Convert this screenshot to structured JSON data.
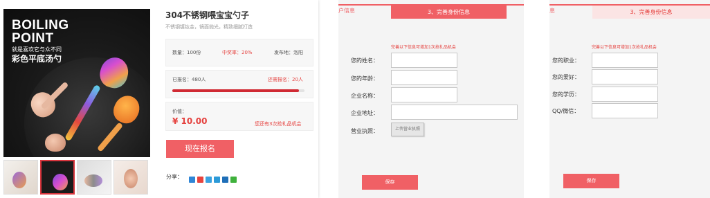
{
  "product": {
    "image_brand_line1": "BOILING",
    "image_brand_line2": "POINT",
    "image_tagline": "就是喜欢它与众不同",
    "image_headline": "彩色平底汤勺",
    "title": "304不锈钢喂宝宝勺子",
    "subtitle": "不锈钢镀钛金，镜面抛光，精致细腻打造",
    "quantity": "数量：100份",
    "win_rate": "中奖率：20%",
    "ship_from": "发布地：洛阳",
    "signed_up": "已报名：480人",
    "remaining": "还需报名：20人",
    "progress_fraction": 0.96,
    "value_label": "价值：",
    "price": "¥ 10.00",
    "chances_note": "您还有3次抢礼品机会",
    "signup_button": "现在报名",
    "share_label": "分享："
  },
  "share_icons": [
    "qzone-icon",
    "sina-weibo-icon",
    "tencent-weibo-icon",
    "qq-icon",
    "renren-icon",
    "wechat-icon"
  ],
  "form1": {
    "prev_tab": "户信息",
    "active_tab": "3、完善身份信息",
    "hint": "完善以下信息可增加1次抢礼品机会",
    "fields": [
      "您的姓名：",
      "您的年龄：",
      "企业名称：",
      "企业地址："
    ],
    "upload_label": "营业执照：",
    "upload_button": "上传营业执照",
    "save": "保存"
  },
  "form2": {
    "prev_tab": "息",
    "active_tab": "3、完善身份信息",
    "hint": "完善以下信息可增加1次抢礼品机会",
    "fields": [
      "您的职业：",
      "您的爱好：",
      "您的学历：",
      "QQ/微信："
    ],
    "save": "保存"
  },
  "colors": {
    "accent": "#f06065",
    "price_red": "#e5413e",
    "progress": "#d02a33"
  }
}
